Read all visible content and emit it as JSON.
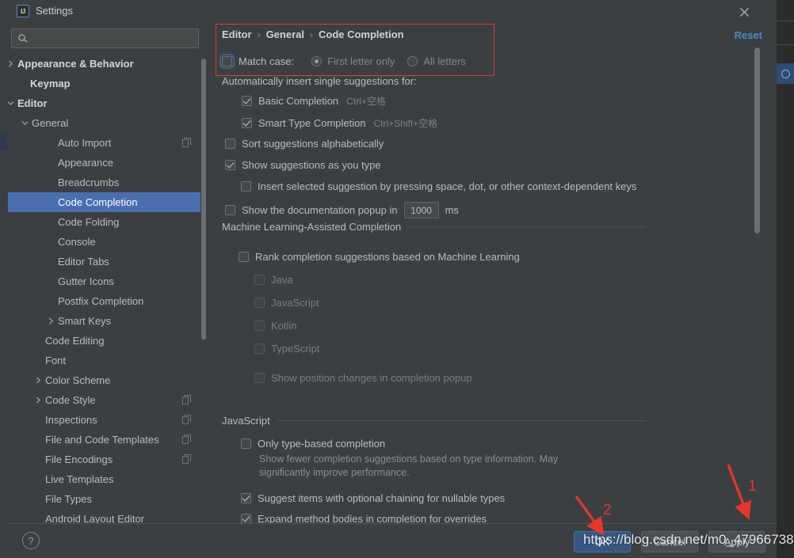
{
  "window": {
    "title": "Settings",
    "app_icon": "intellij-idea-icon",
    "close_icon": "close-icon"
  },
  "search": {
    "value": "",
    "placeholder": "",
    "icon": "search-icon"
  },
  "sidebar": {
    "scrollbar": "vertical-scrollbar",
    "items": [
      {
        "label": "Appearance & Behavior",
        "indent": 12,
        "twisty": "chevron-right",
        "bold": true,
        "selected": false,
        "copy": false
      },
      {
        "label": "Keymap",
        "indent": 28,
        "twisty": "none",
        "bold": true,
        "selected": false,
        "copy": false
      },
      {
        "label": "Editor",
        "indent": 12,
        "twisty": "chevron-down",
        "bold": true,
        "selected": false,
        "copy": false
      },
      {
        "label": "General",
        "indent": 30,
        "twisty": "chevron-down",
        "bold": false,
        "selected": false,
        "copy": false
      },
      {
        "label": "Auto Import",
        "indent": 63,
        "twisty": "none",
        "bold": false,
        "selected": false,
        "copy": true
      },
      {
        "label": "Appearance",
        "indent": 63,
        "twisty": "none",
        "bold": false,
        "selected": false,
        "copy": false
      },
      {
        "label": "Breadcrumbs",
        "indent": 63,
        "twisty": "none",
        "bold": false,
        "selected": false,
        "copy": false
      },
      {
        "label": "Code Completion",
        "indent": 63,
        "twisty": "none",
        "bold": false,
        "selected": true,
        "copy": false
      },
      {
        "label": "Code Folding",
        "indent": 63,
        "twisty": "none",
        "bold": false,
        "selected": false,
        "copy": false
      },
      {
        "label": "Console",
        "indent": 63,
        "twisty": "none",
        "bold": false,
        "selected": false,
        "copy": false
      },
      {
        "label": "Editor Tabs",
        "indent": 63,
        "twisty": "none",
        "bold": false,
        "selected": false,
        "copy": false
      },
      {
        "label": "Gutter Icons",
        "indent": 63,
        "twisty": "none",
        "bold": false,
        "selected": false,
        "copy": false
      },
      {
        "label": "Postfix Completion",
        "indent": 63,
        "twisty": "none",
        "bold": false,
        "selected": false,
        "copy": false
      },
      {
        "label": "Smart Keys",
        "indent": 63,
        "twisty": "chevron-right",
        "bold": false,
        "selected": false,
        "copy": false
      },
      {
        "label": "Code Editing",
        "indent": 47,
        "twisty": "none",
        "bold": false,
        "selected": false,
        "copy": false
      },
      {
        "label": "Font",
        "indent": 47,
        "twisty": "none",
        "bold": false,
        "selected": false,
        "copy": false
      },
      {
        "label": "Color Scheme",
        "indent": 47,
        "twisty": "chevron-right",
        "bold": false,
        "selected": false,
        "copy": false
      },
      {
        "label": "Code Style",
        "indent": 47,
        "twisty": "chevron-right",
        "bold": false,
        "selected": false,
        "copy": true
      },
      {
        "label": "Inspections",
        "indent": 47,
        "twisty": "none",
        "bold": false,
        "selected": false,
        "copy": true
      },
      {
        "label": "File and Code Templates",
        "indent": 47,
        "twisty": "none",
        "bold": false,
        "selected": false,
        "copy": true
      },
      {
        "label": "File Encodings",
        "indent": 47,
        "twisty": "none",
        "bold": false,
        "selected": false,
        "copy": true
      },
      {
        "label": "Live Templates",
        "indent": 47,
        "twisty": "none",
        "bold": false,
        "selected": false,
        "copy": false
      },
      {
        "label": "File Types",
        "indent": 47,
        "twisty": "none",
        "bold": false,
        "selected": false,
        "copy": false
      },
      {
        "label": "Android Layout Editor",
        "indent": 47,
        "twisty": "none",
        "bold": false,
        "selected": false,
        "copy": false
      }
    ]
  },
  "content": {
    "reset_label": "Reset",
    "breadcrumb": [
      "Editor",
      "General",
      "Code Completion"
    ],
    "breadcrumb_separator": "›",
    "match_case": {
      "label": "Match case:",
      "checked": false,
      "options": [
        {
          "label": "First letter only",
          "selected": true
        },
        {
          "label": "All letters",
          "selected": false
        }
      ]
    },
    "auto_insert_heading": "Automatically insert single suggestions for:",
    "auto_insert_items": [
      {
        "label": "Basic Completion",
        "shortcut": "Ctrl+空格",
        "checked": true
      },
      {
        "label": "Smart Type Completion",
        "shortcut": "Ctrl+Shift+空格",
        "checked": true
      }
    ],
    "sort_suggestions": {
      "label": "Sort suggestions alphabetically",
      "checked": false
    },
    "show_suggestions": {
      "label": "Show suggestions as you type",
      "checked": true
    },
    "insert_selected": {
      "label": "Insert selected suggestion by pressing space, dot, or other context-dependent keys",
      "checked": false
    },
    "doc_popup": {
      "label": "Show the documentation popup in",
      "value": "1000",
      "unit": "ms",
      "checked": false
    },
    "ml_section": {
      "title": "Machine Learning-Assisted Completion",
      "rank": {
        "label": "Rank completion suggestions based on Machine Learning",
        "checked": false
      },
      "languages": [
        {
          "label": "Java",
          "checked": false
        },
        {
          "label": "JavaScript",
          "checked": false
        },
        {
          "label": "Kotlin",
          "checked": false
        },
        {
          "label": "TypeScript",
          "checked": false
        }
      ],
      "position_changes": {
        "label": "Show position changes in completion popup",
        "checked": false
      }
    },
    "javascript_section": {
      "title": "JavaScript",
      "only_type_based": {
        "label": "Only type-based completion",
        "checked": false
      },
      "only_type_based_help": "Show fewer completion suggestions based on type information. May\nsignificantly improve performance.",
      "optional_chaining": {
        "label": "Suggest items with optional chaining for nullable types",
        "checked": true
      },
      "expand_method": {
        "label": "Expand method bodies in completion for overrides",
        "checked": true
      }
    }
  },
  "footer": {
    "help_label": "?",
    "ok_label": "OK",
    "cancel_label": "Cancel",
    "apply_label": "Apply"
  },
  "annotations": {
    "marker_1": "1",
    "marker_2": "2",
    "color": "#e8342a"
  },
  "watermark": {
    "text": "https://blog.csdn.net/m0_47966738"
  }
}
